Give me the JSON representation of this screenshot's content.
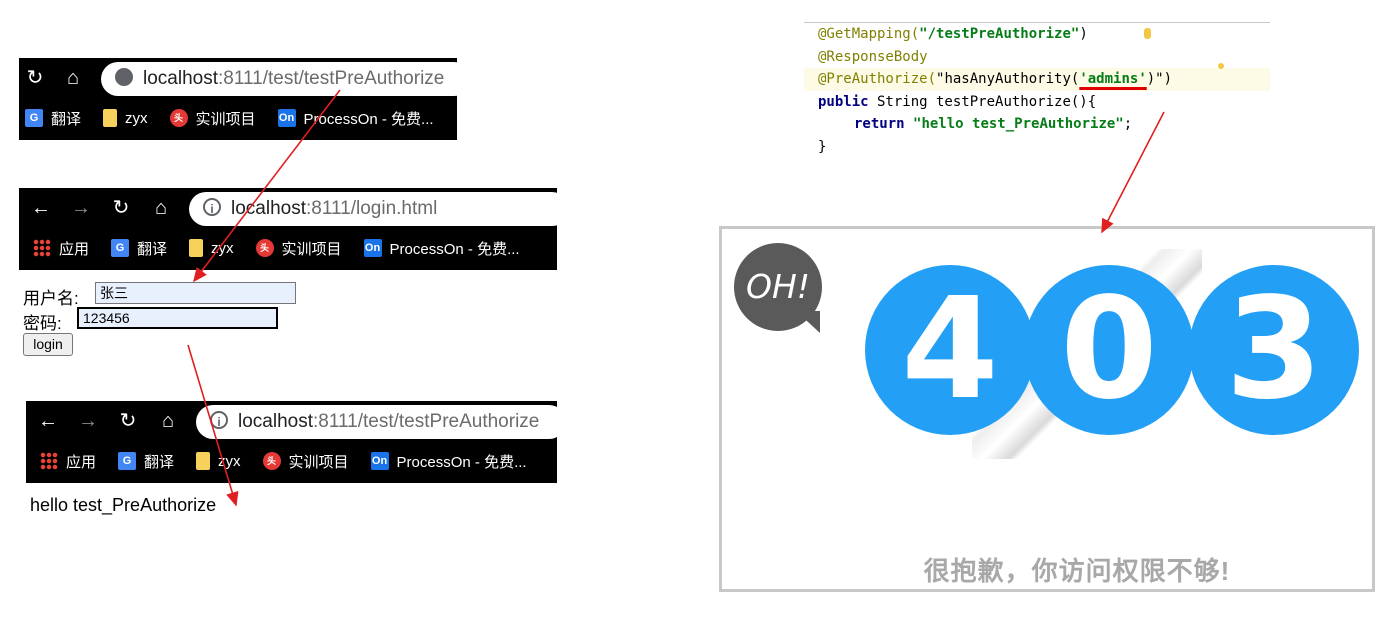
{
  "browser1": {
    "url_host": "localhost",
    "url_rest": ":8111/test/testPreAuthorize",
    "bookmarks": [
      "翻译",
      "zyx",
      "实训项目",
      "ProcessOn - 免费..."
    ]
  },
  "browser2": {
    "url_host": "localhost",
    "url_rest": ":8111/login.html",
    "bookmarks": [
      "应用",
      "翻译",
      "zyx",
      "实训项目",
      "ProcessOn - 免费..."
    ]
  },
  "login_form": {
    "username_label": "用户名:",
    "username_value": "张三",
    "password_label": "密码:",
    "password_value": "123456",
    "login_button": "login"
  },
  "browser3": {
    "url_host": "localhost",
    "url_rest": ":8111/test/testPreAuthorize",
    "bookmarks": [
      "应用",
      "翻译",
      "zyx",
      "实训项目",
      "ProcessOn - 免费..."
    ]
  },
  "response_text": "hello test_PreAuthorize",
  "code": {
    "l1_ann": "@GetMapping(",
    "l1_str": "\"/testPreAuthorize\"",
    "l1_end": ")",
    "l2_ann": "@ResponseBody",
    "l3_ann": "@PreAuthorize(",
    "l3_s1": "\"hasAnyAuthority(",
    "l3_s2": "'admins'",
    "l3_s3": ")\"",
    "l3_end": ")",
    "l4_kw": "public",
    "l4_rest": " String testPreAuthorize(){",
    "l5_kw": "return",
    "l5_str": "\"hello test_PreAuthorize\"",
    "l5_end": ";",
    "l6": "}"
  },
  "error_page": {
    "oh": "OH!",
    "digits": [
      "4",
      "0",
      "3"
    ],
    "message": "很抱歉，你访问权限不够!"
  },
  "icons": {
    "reload": "reload-icon",
    "home": "home-icon",
    "back": "back-arrow-icon",
    "forward": "forward-arrow-icon"
  },
  "colors": {
    "arrow": "#e02020",
    "circle": "#23a0f5"
  }
}
